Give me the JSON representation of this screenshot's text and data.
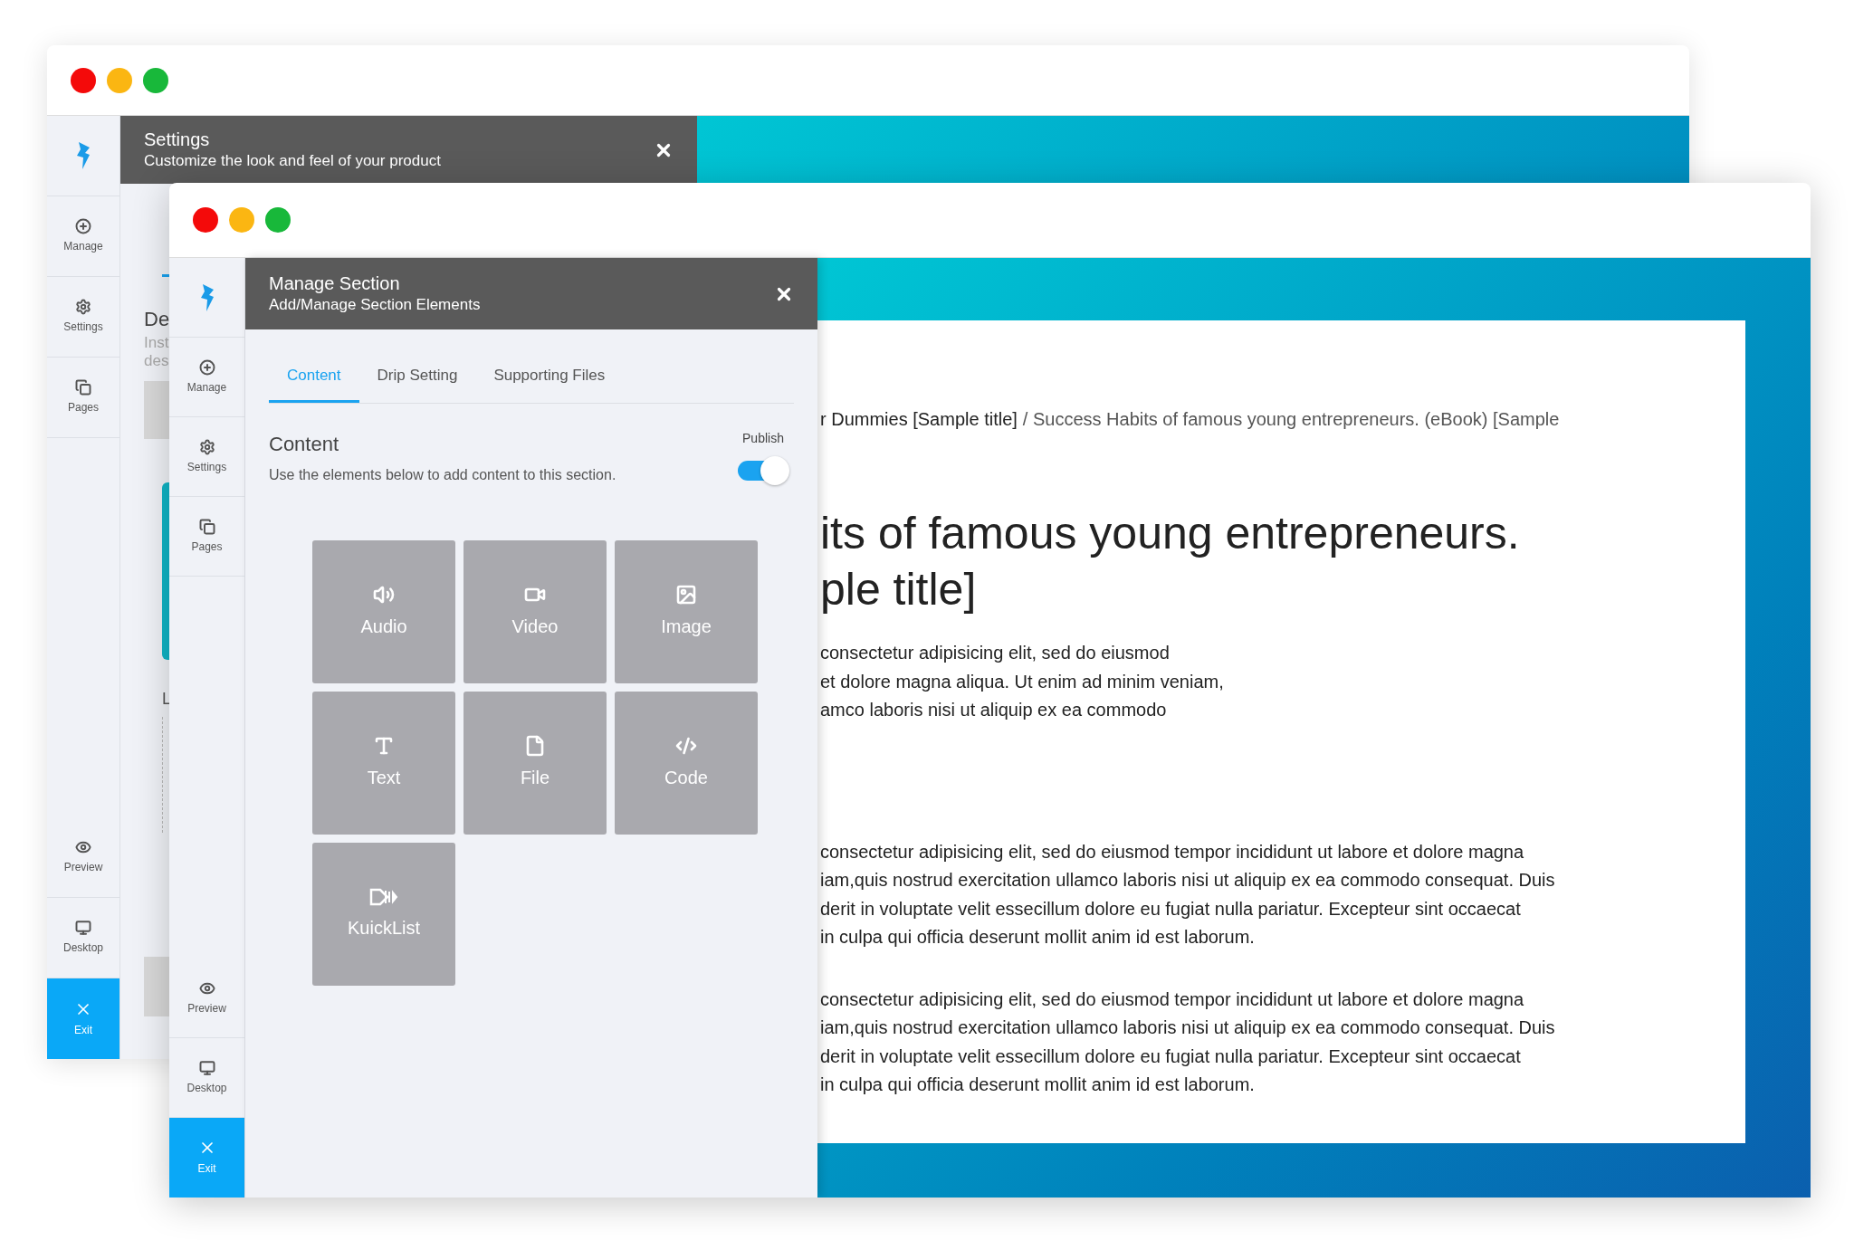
{
  "back_window": {
    "sidebar": [
      {
        "kind": "manage",
        "label": "Manage"
      },
      {
        "kind": "settings",
        "label": "Settings"
      },
      {
        "kind": "pages",
        "label": "Pages"
      },
      {
        "kind": "preview",
        "label": "Preview"
      },
      {
        "kind": "desktop",
        "label": "Desktop"
      },
      {
        "kind": "exit",
        "label": "Exit"
      }
    ],
    "panel": {
      "title": "Settings",
      "subtitle": "Customize the look and feel of your product",
      "heading": "De",
      "description_lines": [
        "Inst",
        "des"
      ],
      "section_label": "L"
    }
  },
  "front_window": {
    "sidebar": [
      {
        "kind": "manage",
        "label": "Manage"
      },
      {
        "kind": "settings",
        "label": "Settings"
      },
      {
        "kind": "pages",
        "label": "Pages"
      },
      {
        "kind": "preview",
        "label": "Preview"
      },
      {
        "kind": "desktop",
        "label": "Desktop"
      },
      {
        "kind": "exit",
        "label": "Exit"
      }
    ],
    "panel": {
      "title": "Manage Section",
      "subtitle": "Add/Manage Section Elements",
      "tabs": [
        {
          "label": "Content",
          "selected": true
        },
        {
          "label": "Drip Setting",
          "selected": false
        },
        {
          "label": "Supporting Files",
          "selected": false
        }
      ],
      "heading": "Content",
      "description": "Use the elements below to add content to this section.",
      "publish": {
        "label": "Publish",
        "on": true
      },
      "tiles": [
        {
          "kind": "audio",
          "label": "Audio"
        },
        {
          "kind": "video",
          "label": "Video"
        },
        {
          "kind": "image",
          "label": "Image"
        },
        {
          "kind": "text",
          "label": "Text"
        },
        {
          "kind": "file",
          "label": "File"
        },
        {
          "kind": "code",
          "label": "Code"
        },
        {
          "kind": "kuicklist",
          "label": "KuickList"
        }
      ]
    },
    "page": {
      "breadcrumb": [
        "r Dummies [Sample title]",
        "/ Success Habits of famous young entrepreneurs. (eBook) [Sample"
      ],
      "title_lines": [
        "its of famous young entrepreneurs.",
        "ple title]"
      ],
      "paragraphs": [
        [
          "consectetur adipisicing elit, sed do eiusmod",
          "et dolore magna aliqua. Ut enim ad minim veniam,",
          "amco laboris nisi ut aliquip ex ea commodo"
        ],
        [
          "consectetur adipisicing elit, sed do eiusmod tempor incididunt ut labore et dolore magna",
          "iam,quis nostrud exercitation ullamco laboris nisi ut aliquip ex ea commodo consequat. Duis",
          "derit in voluptate velit essecillum dolore eu fugiat nulla pariatur. Excepteur sint occaecat",
          "in culpa qui officia deserunt mollit anim id est laborum."
        ],
        [
          "consectetur adipisicing elit, sed do eiusmod tempor incididunt ut labore et dolore magna",
          "iam,quis nostrud exercitation ullamco laboris nisi ut aliquip ex ea commodo consequat. Duis",
          "derit in voluptate velit essecillum dolore eu fugiat nulla pariatur. Excepteur sint occaecat",
          "in culpa qui officia deserunt mollit anim id est laborum."
        ]
      ]
    }
  }
}
